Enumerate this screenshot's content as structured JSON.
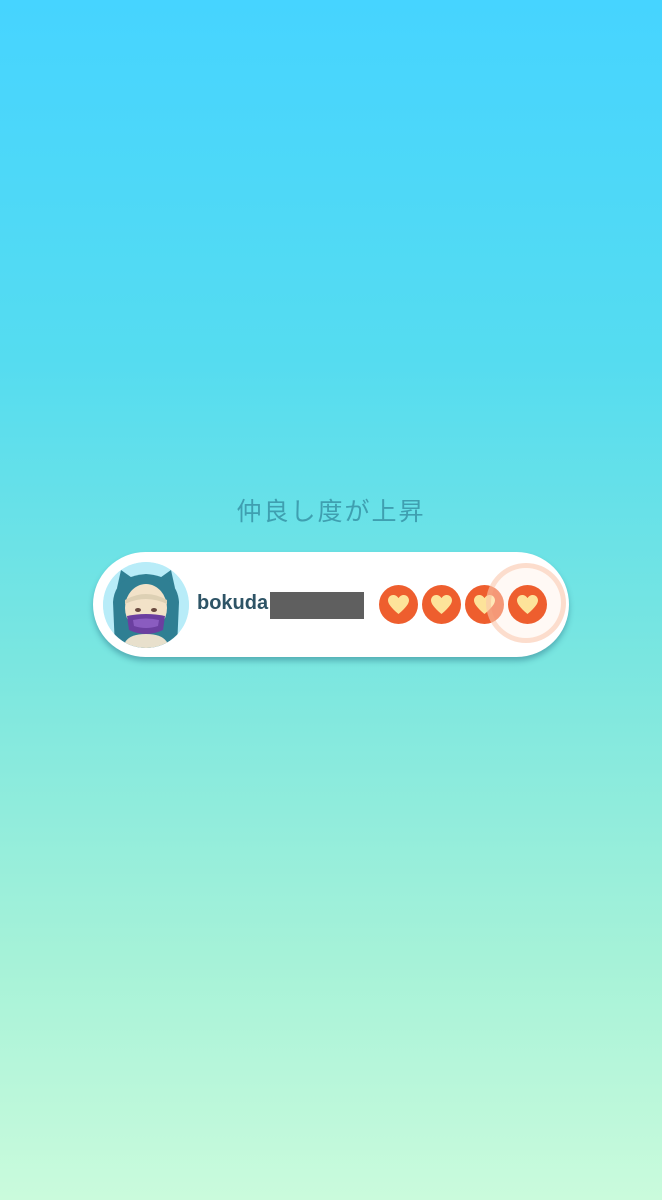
{
  "screen": {
    "title": "仲良し度が上昇",
    "background_top": "#46d4ff",
    "background_bottom": "#cafbdc"
  },
  "friend": {
    "username": "bokuda",
    "avatar_icon": "snorlax-hood-avatar",
    "name_redacted": true,
    "friendship_hearts_filled": 4,
    "friendship_hearts_total": 4,
    "heart_icon": "heart-icon",
    "heart_badge_color": "#ee5e2e",
    "heart_fill_color": "#fde39a"
  }
}
